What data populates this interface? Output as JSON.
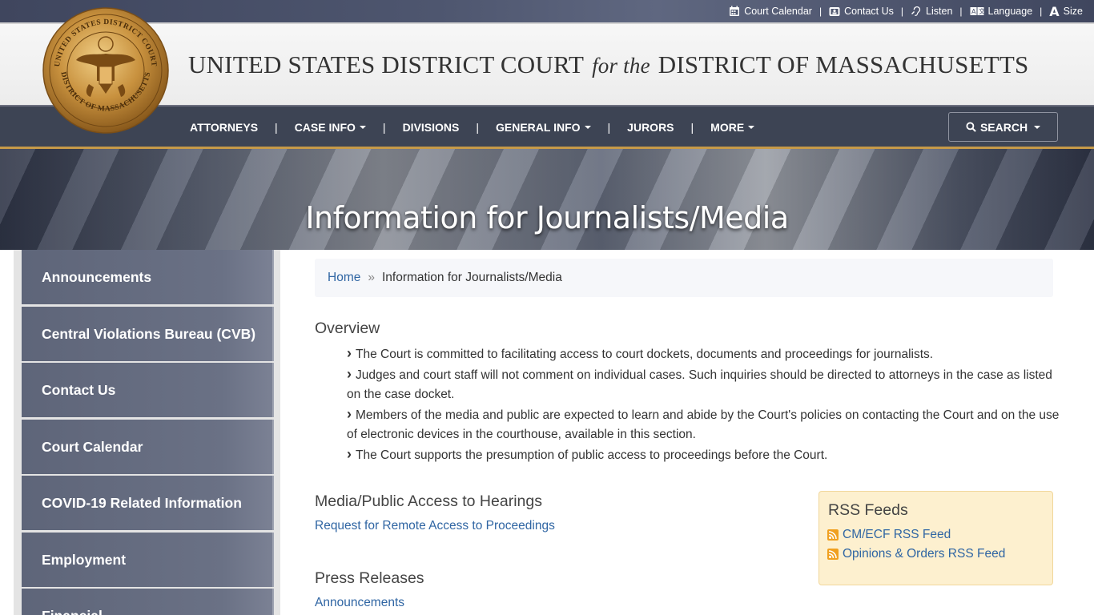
{
  "utility_links": [
    {
      "label": "Court Calendar",
      "icon": "calendar-icon"
    },
    {
      "label": "Contact Us",
      "icon": "contact-icon"
    },
    {
      "label": "Listen",
      "icon": "listen-icon"
    },
    {
      "label": "Language",
      "icon": "language-icon"
    },
    {
      "label": "Size",
      "icon": "text-size-icon"
    }
  ],
  "header": {
    "title_left": "UNITED STATES DISTRICT COURT",
    "title_for": "for the",
    "title_right": "DISTRICT OF MASSACHUSETTS",
    "seal_top_text": "UNITED STATES DISTRICT COURT",
    "seal_bottom_text": "DISTRICT OF MASSACHUSETTS"
  },
  "nav": {
    "items": [
      {
        "label": "ATTORNEYS",
        "dropdown": false
      },
      {
        "label": "CASE INFO",
        "dropdown": true
      },
      {
        "label": "DIVISIONS",
        "dropdown": false
      },
      {
        "label": "GENERAL INFO",
        "dropdown": true
      },
      {
        "label": "JURORS",
        "dropdown": false
      },
      {
        "label": "MORE",
        "dropdown": true
      }
    ],
    "search_label": "SEARCH"
  },
  "hero": {
    "title": "Information for Journalists/Media"
  },
  "sidebar": {
    "items": [
      {
        "label": "Announcements"
      },
      {
        "label": "Central Violations Bureau (CVB)"
      },
      {
        "label": "Contact Us"
      },
      {
        "label": "Court Calendar"
      },
      {
        "label": "COVID-19 Related Information"
      },
      {
        "label": "Employment"
      },
      {
        "label": "Financial"
      }
    ]
  },
  "breadcrumb": {
    "home": "Home",
    "separator": "»",
    "current": "Information for Journalists/Media"
  },
  "overview": {
    "heading": "Overview",
    "items": [
      "The Court is committed to facilitating access to court dockets, documents and proceedings for journalists.",
      "Judges and court staff will not comment on individual cases. Such inquiries should be directed to attorneys in the case as listed on the case docket.",
      "Members of the media and public are expected to learn and abide by the Court's policies on contacting the Court and on the use of electronic devices in the courthouse, available in this section.",
      "The Court supports the presumption of public access to proceedings before the Court."
    ]
  },
  "media_access": {
    "heading": "Media/Public Access to Hearings",
    "link": "Request for Remote Access to Proceedings"
  },
  "press": {
    "heading": "Press Releases",
    "link": "Announcements"
  },
  "rss": {
    "title": "RSS Feeds",
    "feeds": [
      "CM/ECF RSS Feed",
      "Opinions & Orders RSS Feed"
    ]
  },
  "colors": {
    "nav_bg": "#3d4454",
    "accent_gold": "#c79a48",
    "link": "#2f65a3",
    "rss_bg": "#fdf0cf"
  }
}
